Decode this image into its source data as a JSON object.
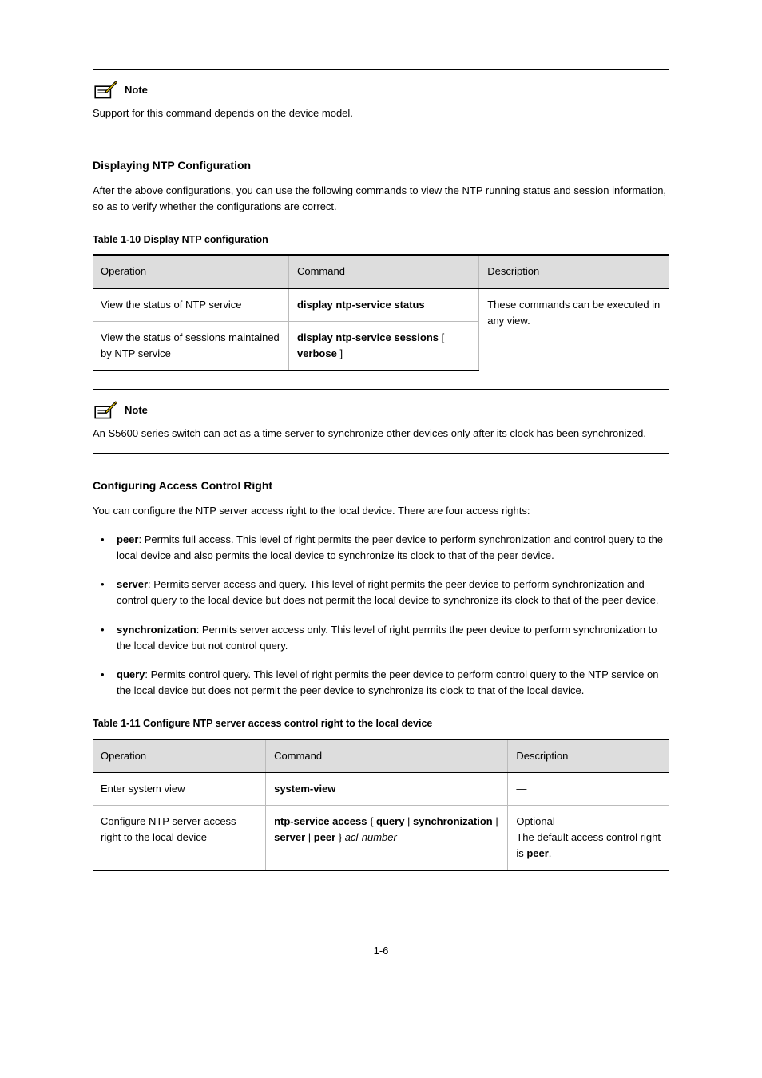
{
  "note1": {
    "label": "Note",
    "text": "Support for this command depends on the device model."
  },
  "section1": {
    "title": "Displaying NTP Configuration",
    "intro": "After the above configurations, you can use the following commands to view the NTP running status and session information, so as to verify whether the configurations are correct.",
    "tableCaption": "Table 1-10 Display NTP configuration"
  },
  "table1": {
    "headers": [
      "Operation",
      "Command",
      "Description"
    ],
    "rows": [
      {
        "op": "View the status of NTP service",
        "cmd": "display ntp-service status",
        "desc_prefix": "These commands can be executed in any view.",
        "desc_rowspan": 2
      },
      {
        "op": "View the status of sessions maintained by NTP service",
        "cmd_parts": [
          "display ntp-service sessions",
          " [ ",
          "verbose",
          " ]"
        ]
      }
    ]
  },
  "note2": {
    "label": "Note",
    "text": "An S5600 series switch can act as a time server to synchronize other devices only after its clock has been synchronized."
  },
  "section2": {
    "title": "Configuring Access Control Right",
    "intro": "You can configure the NTP server access right to the local device. There are four access rights:",
    "bullets": [
      {
        "lead": "peer",
        "rest": ": Permits full access. This level of right permits the peer device to perform synchronization and control query to the local device and also permits the local device to synchronize its clock to that of the peer device."
      },
      {
        "lead": "server",
        "rest": ": Permits server access and query. This level of right permits the peer device to perform synchronization and control query to the local device but does not permit the local device to synchronize its clock to that of the peer device."
      },
      {
        "lead": "synchronization",
        "rest": ": Permits server access only. This level of right permits the peer device to perform synchronization to the local device but not control query."
      },
      {
        "lead": "query",
        "rest": ": Permits control query. This level of right permits the peer device to perform control query to the NTP service on the local device but does not permit the peer device to synchronize its clock to that of the local device."
      }
    ],
    "tableCaption": "Table 1-11 Configure NTP server access control right to the local device"
  },
  "table2": {
    "headers": [
      "Operation",
      "Command",
      "Description"
    ],
    "rows": [
      {
        "op": "Enter system view",
        "cmd": "system-view",
        "desc": "—"
      },
      {
        "op": "Configure NTP server access right to the local device",
        "cmd_parts": [
          "ntp-service access",
          " { ",
          "query",
          " | ",
          "synchronization",
          " | ",
          "server",
          " | ",
          "peer",
          " } ",
          "acl-number"
        ],
        "desc_lines": [
          "Optional",
          "The default access control right is ",
          "peer",
          "."
        ]
      }
    ]
  },
  "footer": "1-6"
}
